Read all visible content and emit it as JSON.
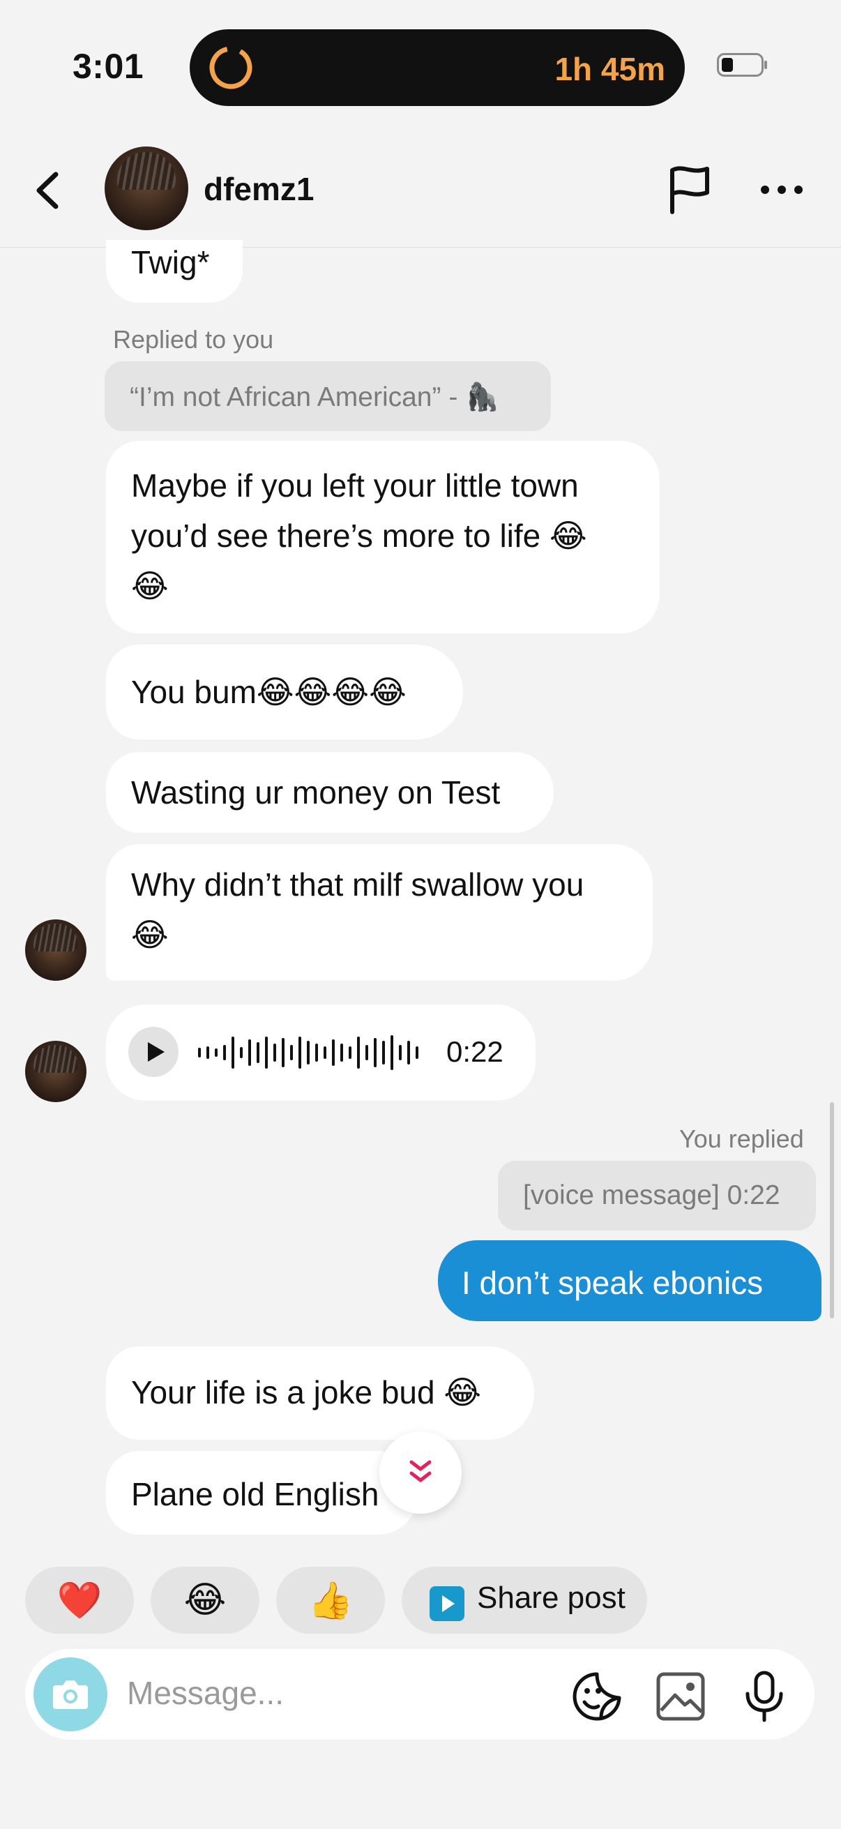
{
  "status_bar": {
    "time": "3:01",
    "timer": "1h 45m"
  },
  "header": {
    "username": "dfemz1"
  },
  "messages": {
    "twig": "Twig*",
    "replied_label": "Replied to you",
    "quoted_text": "“I’m not African American” - ",
    "quoted_emoji": "🦍",
    "m1_line1": "Maybe if you left your little town",
    "m1_line2": "you’d see there’s more to life ",
    "m1_emoji_a": "😂",
    "m1_emoji_b": "😂",
    "m2_text": "You bum",
    "m2_emoji": "😂😂😂😂",
    "m3_text": "Wasting ur money on Test",
    "m4_line1": "Why didn’t that milf swallow you",
    "m4_emoji": "😂",
    "voice_duration": "0:22",
    "you_replied_label": "You replied",
    "you_quoted": "[voice message] 0:22",
    "my_message": "I don’t speak ebonics",
    "m5_text": "Your life is a joke bud ",
    "m5_emoji": "😂",
    "m6_text": "Plane old English"
  },
  "quick_reactions": {
    "heart": "❤️",
    "laugh": "😂",
    "thumbs_up": "👍",
    "share_post_label": "Share post"
  },
  "composer": {
    "placeholder": "Message..."
  },
  "colors": {
    "accent_blue": "#1a8fd6",
    "timer_orange": "#f4a34a",
    "scroll_chevron": "#e0245e"
  }
}
